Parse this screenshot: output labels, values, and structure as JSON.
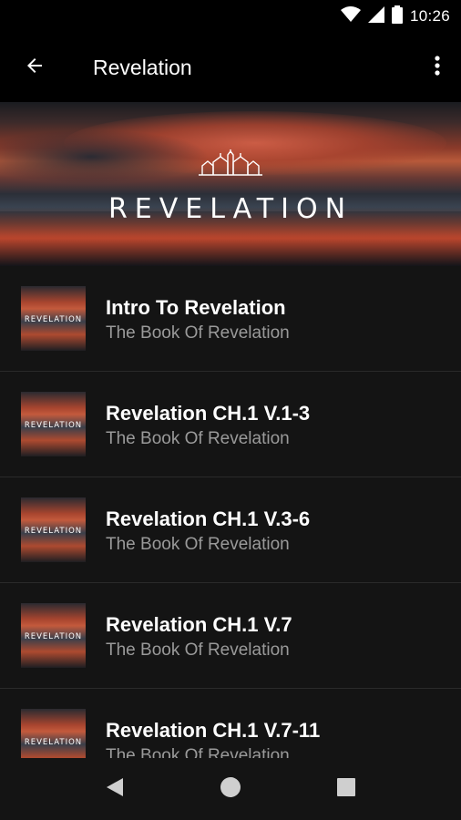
{
  "status_bar": {
    "time": "10:26"
  },
  "app_bar": {
    "title": "Revelation"
  },
  "banner": {
    "title": "REVELATION"
  },
  "thumb_label": "REVELATION",
  "items": [
    {
      "title": "Intro To Revelation",
      "subtitle": "The Book Of Revelation"
    },
    {
      "title": "Revelation CH.1 V.1-3",
      "subtitle": "The Book Of Revelation"
    },
    {
      "title": "Revelation CH.1 V.3-6",
      "subtitle": "The Book Of Revelation"
    },
    {
      "title": "Revelation CH.1 V.7",
      "subtitle": "The Book Of Revelation"
    },
    {
      "title": "Revelation CH.1 V.7-11",
      "subtitle": "The Book Of Revelation"
    }
  ],
  "colors": {
    "background": "#141414",
    "bar": "#000000",
    "subtitle": "#9a9a9a"
  },
  "icons": [
    "wifi-icon",
    "signal-icon",
    "battery-icon",
    "back-arrow-icon",
    "more-vert-icon",
    "nav-back-icon",
    "nav-home-icon",
    "nav-recents-icon"
  ]
}
